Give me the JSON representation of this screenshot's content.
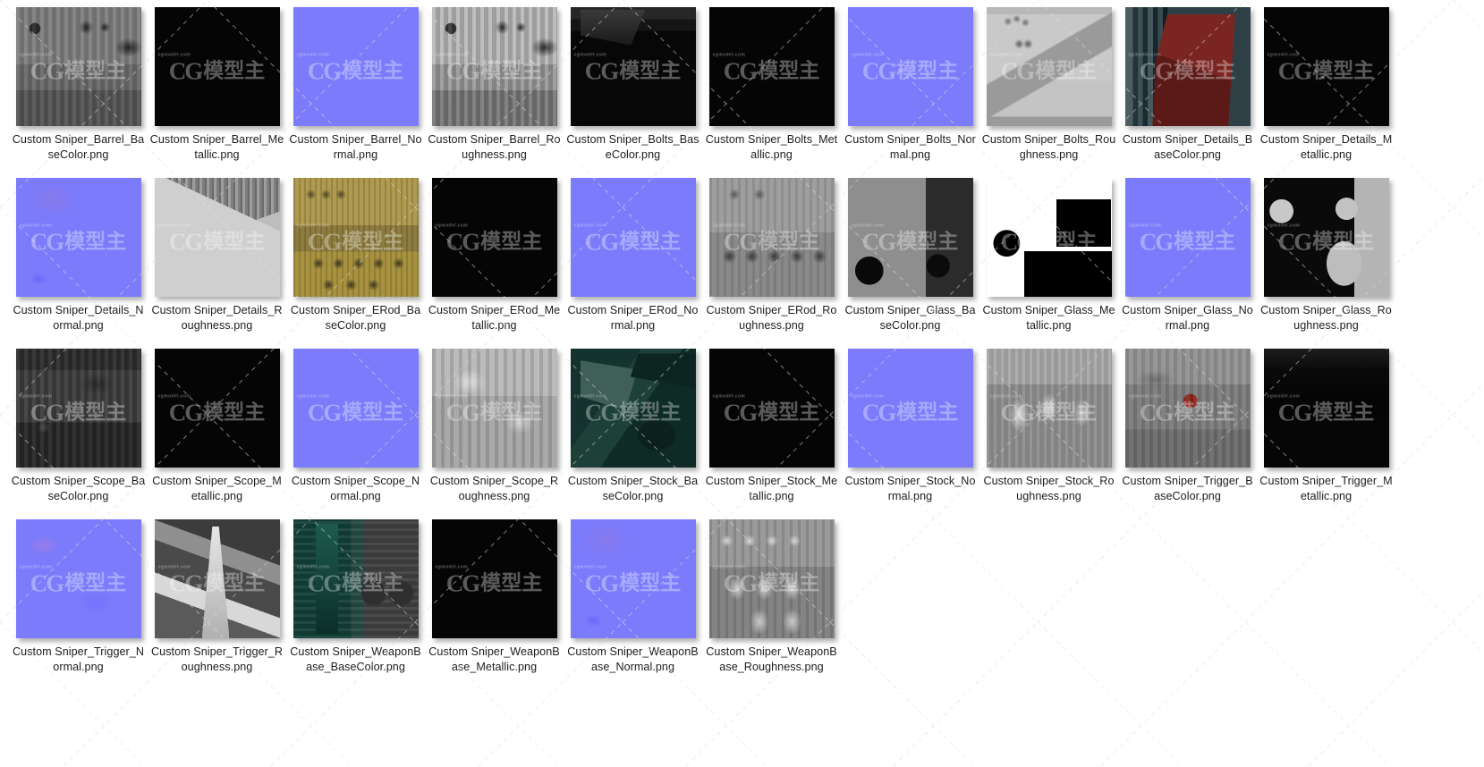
{
  "view": {
    "type": "file-thumbnail-grid",
    "columns": 10,
    "rows": 4,
    "total_items": 36,
    "background_color": "#ffffff",
    "label_color": "#1c1c1c",
    "watermark_text": "CG模型主",
    "watermark_subtext": "cgmodel.com"
  },
  "files": [
    {
      "prefix": "Custom",
      "name": "Sniper_Barrel_BaseColor.png",
      "thumb": "tex-barrel-base"
    },
    {
      "prefix": "Custom",
      "name": "Sniper_Barrel_Metallic.png",
      "thumb": "tex-black"
    },
    {
      "prefix": "Custom",
      "name": "Sniper_Barrel_Normal.png",
      "thumb": "tex-normal"
    },
    {
      "prefix": "Custom",
      "name": "Sniper_Barrel_Roughness.png",
      "thumb": "tex-barrel-base tex-barrel-rough"
    },
    {
      "prefix": "Custom",
      "name": "Sniper_Bolts_BaseColor.png",
      "thumb": "tex-bolts-base"
    },
    {
      "prefix": "Custom",
      "name": "Sniper_Bolts_Metallic.png",
      "thumb": "tex-black"
    },
    {
      "prefix": "Custom",
      "name": "Sniper_Bolts_Normal.png",
      "thumb": "tex-normal"
    },
    {
      "prefix": "Custom",
      "name": "Sniper_Bolts_Roughness.png",
      "thumb": "tex-bolts-rough"
    },
    {
      "prefix": "Custom",
      "name": "Sniper_Details_BaseColor.png",
      "thumb": "tex-details-base"
    },
    {
      "prefix": "Custom",
      "name": "Sniper_Details_Metallic.png",
      "thumb": "tex-black"
    },
    {
      "prefix": "Custom",
      "name": "Sniper_Details_Normal.png",
      "thumb": "tex-normal variant-b"
    },
    {
      "prefix": "Custom",
      "name": "Sniper_Details_Roughness.png",
      "thumb": "tex-details-rough"
    },
    {
      "prefix": "Custom",
      "name": "Sniper_ERod_BaseColor.png",
      "thumb": "tex-erod-base"
    },
    {
      "prefix": "Custom",
      "name": "Sniper_ERod_Metallic.png",
      "thumb": "tex-black"
    },
    {
      "prefix": "Custom",
      "name": "Sniper_ERod_Normal.png",
      "thumb": "tex-normal"
    },
    {
      "prefix": "Custom",
      "name": "Sniper_ERod_Roughness.png",
      "thumb": "tex-erod-rough"
    },
    {
      "prefix": "Custom",
      "name": "Sniper_Glass_BaseColor.png",
      "thumb": "tex-glass-base"
    },
    {
      "prefix": "Custom",
      "name": "Sniper_Glass_Metallic.png",
      "thumb": "tex-glass-metal"
    },
    {
      "prefix": "Custom",
      "name": "Sniper_Glass_Normal.png",
      "thumb": "tex-normal"
    },
    {
      "prefix": "Custom",
      "name": "Sniper_Glass_Roughness.png",
      "thumb": "tex-glass-rough"
    },
    {
      "prefix": "Custom",
      "name": "Sniper_Scope_BaseColor.png",
      "thumb": "tex-scope-base"
    },
    {
      "prefix": "Custom",
      "name": "Sniper_Scope_Metallic.png",
      "thumb": "tex-black"
    },
    {
      "prefix": "Custom",
      "name": "Sniper_Scope_Normal.png",
      "thumb": "tex-normal"
    },
    {
      "prefix": "Custom",
      "name": "Sniper_Scope_Roughness.png",
      "thumb": "tex-scope-rough"
    },
    {
      "prefix": "Custom",
      "name": "Sniper_Stock_BaseColor.png",
      "thumb": "tex-stock-base"
    },
    {
      "prefix": "Custom",
      "name": "Sniper_Stock_Metallic.png",
      "thumb": "tex-black"
    },
    {
      "prefix": "Custom",
      "name": "Sniper_Stock_Normal.png",
      "thumb": "tex-normal"
    },
    {
      "prefix": "Custom",
      "name": "Sniper_Stock_Roughness.png",
      "thumb": "tex-stock-rough"
    },
    {
      "prefix": "Custom",
      "name": "Sniper_Trigger_BaseColor.png",
      "thumb": "tex-trigger-base"
    },
    {
      "prefix": "Custom",
      "name": "Sniper_Trigger_Metallic.png",
      "thumb": "tex-black-soft"
    },
    {
      "prefix": "Custom",
      "name": "Sniper_Trigger_Normal.png",
      "thumb": "tex-normal variant-c"
    },
    {
      "prefix": "Custom",
      "name": "Sniper_Trigger_Roughness.png",
      "thumb": "tex-trigger-rough"
    },
    {
      "prefix": "Custom",
      "name": "Sniper_WeaponBase_BaseColor.png",
      "thumb": "tex-weapon-base"
    },
    {
      "prefix": "Custom",
      "name": "Sniper_WeaponBase_Metallic.png",
      "thumb": "tex-black"
    },
    {
      "prefix": "Custom",
      "name": "Sniper_WeaponBase_Normal.png",
      "thumb": "tex-normal variant-b"
    },
    {
      "prefix": "Custom",
      "name": "Sniper_WeaponBase_Roughness.png",
      "thumb": "tex-weapon-rough"
    }
  ]
}
